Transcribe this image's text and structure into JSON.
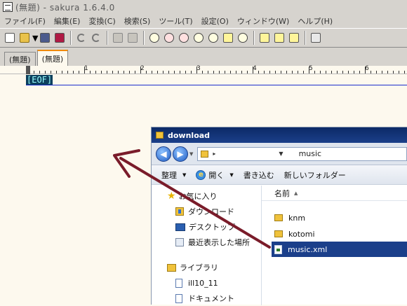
{
  "window": {
    "title": "(無題) - sakura  1.6.4.0"
  },
  "menu": [
    "ファイル(F)",
    "編集(E)",
    "変換(C)",
    "検索(S)",
    "ツール(T)",
    "設定(O)",
    "ウィンドウ(W)",
    "ヘルプ(H)"
  ],
  "toolbar": {
    "buttons": [
      "new-file-icon",
      "open-file-icon",
      "save-icon",
      "save-all-icon",
      "undo-icon",
      "redo-icon",
      "jump-back-icon",
      "jump-forward-icon",
      "search-icon",
      "search-next-icon",
      "search-prev-icon",
      "replace-icon",
      "delete-mark-icon",
      "mark-check-icon",
      "grep-icon",
      "tag-jump-icon",
      "compare-icon",
      "outline-icon"
    ]
  },
  "tabs": [
    {
      "label": "(無題)",
      "active": false
    },
    {
      "label": "(無題)",
      "active": true
    }
  ],
  "ruler": {
    "labels": [
      "1",
      "2",
      "3",
      "4",
      "5",
      "6"
    ]
  },
  "editor": {
    "eof": "[EOF]"
  },
  "explorer": {
    "title": "download",
    "address": "music",
    "commands": {
      "organize": "整理",
      "open": "開く",
      "burn": "書き込む",
      "new_folder": "新しいフォルダー"
    },
    "nav": {
      "favorites": "お気に入り",
      "downloads": "ダウンロード",
      "desktop": "デスクトップ",
      "recent": "最近表示した場所",
      "library": "ライブラリ",
      "ill": "ill10_11",
      "documents": "ドキュメント"
    },
    "column_name": "名前",
    "files": [
      {
        "name": "knm",
        "type": "folder",
        "selected": false
      },
      {
        "name": "kotomi",
        "type": "folder",
        "selected": false
      },
      {
        "name": "music.xml",
        "type": "xml",
        "selected": true
      }
    ]
  },
  "colors": {
    "editor_bg": "#fdf9ee",
    "eof_bg": "#0c3f5c",
    "selection": "#1b3f8a",
    "arrow": "#7a1c2a"
  }
}
